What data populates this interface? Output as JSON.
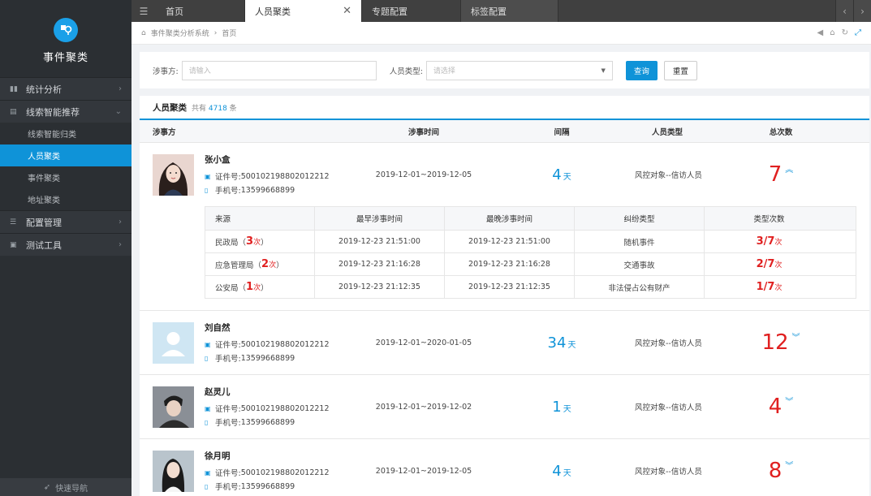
{
  "app": {
    "title": "事件聚类",
    "quick_nav": "快速导航",
    "accent": "#0f93d8"
  },
  "sidebar": {
    "items": [
      {
        "label": "统计分析",
        "icon": "bar-chart-icon",
        "expanded": false
      },
      {
        "label": "线索智能推荐",
        "icon": "list-icon",
        "expanded": true,
        "children": [
          {
            "label": "线索智能归类",
            "active": false
          },
          {
            "label": "人员聚类",
            "active": true
          },
          {
            "label": "事件聚类",
            "active": false
          },
          {
            "label": "地址聚类",
            "active": false
          }
        ]
      },
      {
        "label": "配置管理",
        "icon": "sliders-icon",
        "expanded": false
      },
      {
        "label": "测试工具",
        "icon": "briefcase-icon",
        "expanded": false
      }
    ]
  },
  "tabs": [
    {
      "label": "首页",
      "active": false
    },
    {
      "label": "人员聚类",
      "active": true,
      "closable": true
    },
    {
      "label": "专题配置",
      "active": false
    },
    {
      "label": "标签配置",
      "active": false
    }
  ],
  "breadcrumb": {
    "root": "事件聚类分析系统",
    "current": "首页"
  },
  "search": {
    "party_label": "涉事方:",
    "party_placeholder": "请输入",
    "type_label": "人员类型:",
    "type_placeholder": "请选择",
    "query_button": "查询",
    "reset_button": "重置"
  },
  "panel": {
    "title": "人员聚类",
    "count_prefix": "共有",
    "count": "4718",
    "count_suffix": "条"
  },
  "columns": [
    "涉事方",
    "涉事时间",
    "间隔",
    "人员类型",
    "总次数"
  ],
  "id_label": "证件号:",
  "phone_label": "手机号:",
  "day_unit": "天",
  "times_unit": "次",
  "people": [
    {
      "name": "张小盒",
      "id_no": "500102198802012212",
      "phone": "13599668899",
      "time_range": "2019-12-01~2019-12-05",
      "interval": "4",
      "type": "风控对象--信访人员",
      "total": "7",
      "expanded": true,
      "avatar": "girl-photo",
      "details": {
        "headers": [
          "来源",
          "最早涉事时间",
          "最晚涉事时间",
          "纠纷类型",
          "类型次数"
        ],
        "rows": [
          {
            "source": "民政局",
            "count": "3",
            "earliest": "2019-12-23 21:51:00",
            "latest": "2019-12-23 21:51:00",
            "dispute": "随机事件",
            "ratio": "3/7"
          },
          {
            "source": "应急管理局",
            "count": "2",
            "earliest": "2019-12-23 21:16:28",
            "latest": "2019-12-23 21:16:28",
            "dispute": "交通事故",
            "ratio": "2/7"
          },
          {
            "source": "公安局",
            "count": "1",
            "earliest": "2019-12-23 21:12:35",
            "latest": "2019-12-23 21:12:35",
            "dispute": "非法侵占公有财产",
            "ratio": "1/7"
          }
        ]
      }
    },
    {
      "name": "刘自然",
      "id_no": "500102198802012212",
      "phone": "13599668899",
      "time_range": "2019-12-01~2020-01-05",
      "interval": "34",
      "type": "风控对象--信访人员",
      "total": "12",
      "expanded": false,
      "avatar": "placeholder-avatar"
    },
    {
      "name": "赵灵儿",
      "id_no": "500102198802012212",
      "phone": "13599668899",
      "time_range": "2019-12-01~2019-12-02",
      "interval": "1",
      "type": "风控对象--信访人员",
      "total": "4",
      "expanded": false,
      "avatar": "man-photo"
    },
    {
      "name": "徐月明",
      "id_no": "500102198802012212",
      "phone": "13599668899",
      "time_range": "2019-12-01~2019-12-05",
      "interval": "4",
      "type": "风控对象--信访人员",
      "total": "8",
      "expanded": false,
      "avatar": "woman-photo"
    }
  ]
}
